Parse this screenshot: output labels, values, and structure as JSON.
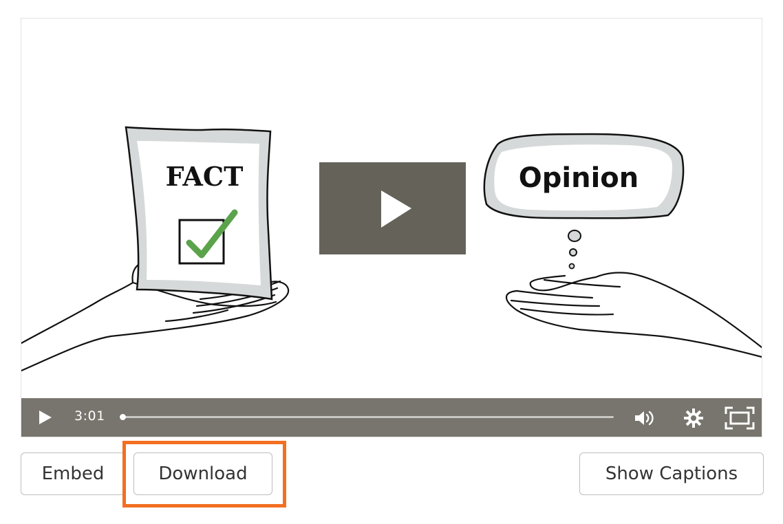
{
  "video": {
    "fact_label": "FACT",
    "opinion_label": "Opinion",
    "current_time": "3:01",
    "progress_fraction": 0
  },
  "controls": {
    "play_icon": "play-icon",
    "volume_icon": "volume-icon",
    "settings_icon": "gear-icon",
    "fullscreen_icon": "fullscreen-icon"
  },
  "buttons": {
    "embed": "Embed",
    "download": "Download",
    "show_captions": "Show Captions"
  },
  "colors": {
    "overlay_play": "#65625a",
    "control_bar": "#77756d",
    "highlight": "#f36f21",
    "check": "#5aa34a"
  }
}
